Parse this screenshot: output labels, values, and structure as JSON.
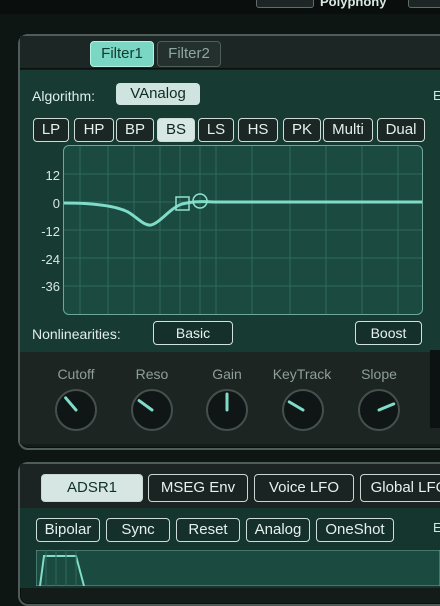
{
  "top": {
    "polyphony_label": "Polyphony"
  },
  "filter": {
    "tabs": [
      {
        "label": "Filter1",
        "active": true
      },
      {
        "label": "Filter2",
        "active": false
      }
    ],
    "algorithm_label": "Algorithm:",
    "algorithm_value": "VAnalog",
    "right_edge_letter": "E",
    "types": [
      "LP",
      "HP",
      "BP",
      "BS",
      "LS",
      "HS",
      "PK",
      "Multi",
      "Dual"
    ],
    "selected_type": "BS",
    "graph": {
      "y_ticks": [
        "12",
        "0",
        "-12",
        "-24",
        "-36"
      ],
      "curve_color": "#7fdcc8"
    },
    "nonlinearities_label": "Nonlinearities:",
    "nonlinearities_value": "Basic",
    "boost_label": "Boost",
    "knobs": [
      {
        "label": "Cutoff",
        "value": 0.35
      },
      {
        "label": "Reso",
        "value": 0.3
      },
      {
        "label": "Gain",
        "value": 0.5
      },
      {
        "label": "KeyTrack",
        "value": 0.28
      },
      {
        "label": "Slope",
        "value": 0.75
      }
    ]
  },
  "envelope": {
    "tabs": [
      {
        "label": "ADSR1",
        "active": true
      },
      {
        "label": "MSEG Env",
        "active": false
      },
      {
        "label": "Voice LFO",
        "active": false
      },
      {
        "label": "Global LFO",
        "active": false
      }
    ],
    "buttons": [
      "Bipolar",
      "Sync",
      "Reset",
      "Analog",
      "OneShot"
    ],
    "right_edge_letter": "E"
  },
  "colors": {
    "accent": "#7ad7c3",
    "panel": "#173a33"
  }
}
